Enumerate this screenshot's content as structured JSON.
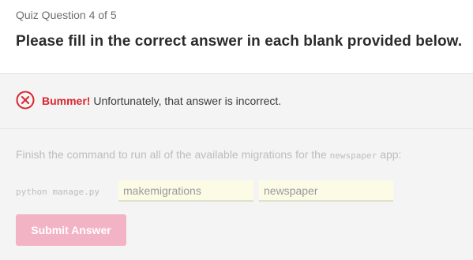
{
  "quiz": {
    "progress_label": "Quiz Question 4 of 5",
    "question": "Please fill in the correct answer in each blank provided below."
  },
  "feedback": {
    "icon": "x-circle-icon",
    "status_color": "#d8262f",
    "headline": "Bummer!",
    "message": " Unfortunately, that answer is incorrect."
  },
  "challenge": {
    "prompt_before": "Finish the command to run all of the available migrations for the ",
    "prompt_code": "newspaper",
    "prompt_after": " app:",
    "command_prefix": "python manage.py",
    "blanks": [
      {
        "value": "makemigrations"
      },
      {
        "value": "newspaper"
      }
    ],
    "submit_label": "Submit Answer",
    "submit_color": "#f2b4c5"
  }
}
